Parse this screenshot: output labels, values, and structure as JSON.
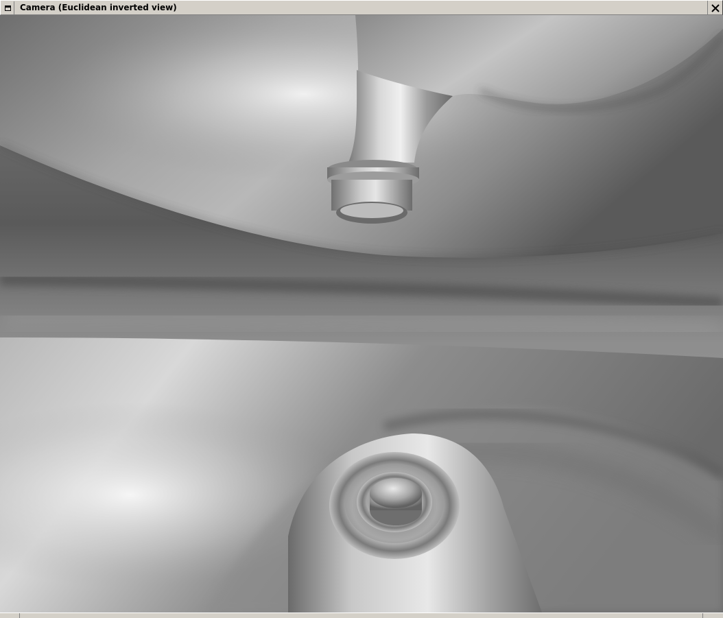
{
  "window": {
    "title": "Camera (Euclidean inverted view)",
    "sysmenu_icon": "window-menu-icon",
    "close_icon": "close-icon"
  },
  "viewport": {
    "content": "3d-render",
    "shading": "grayscale"
  }
}
